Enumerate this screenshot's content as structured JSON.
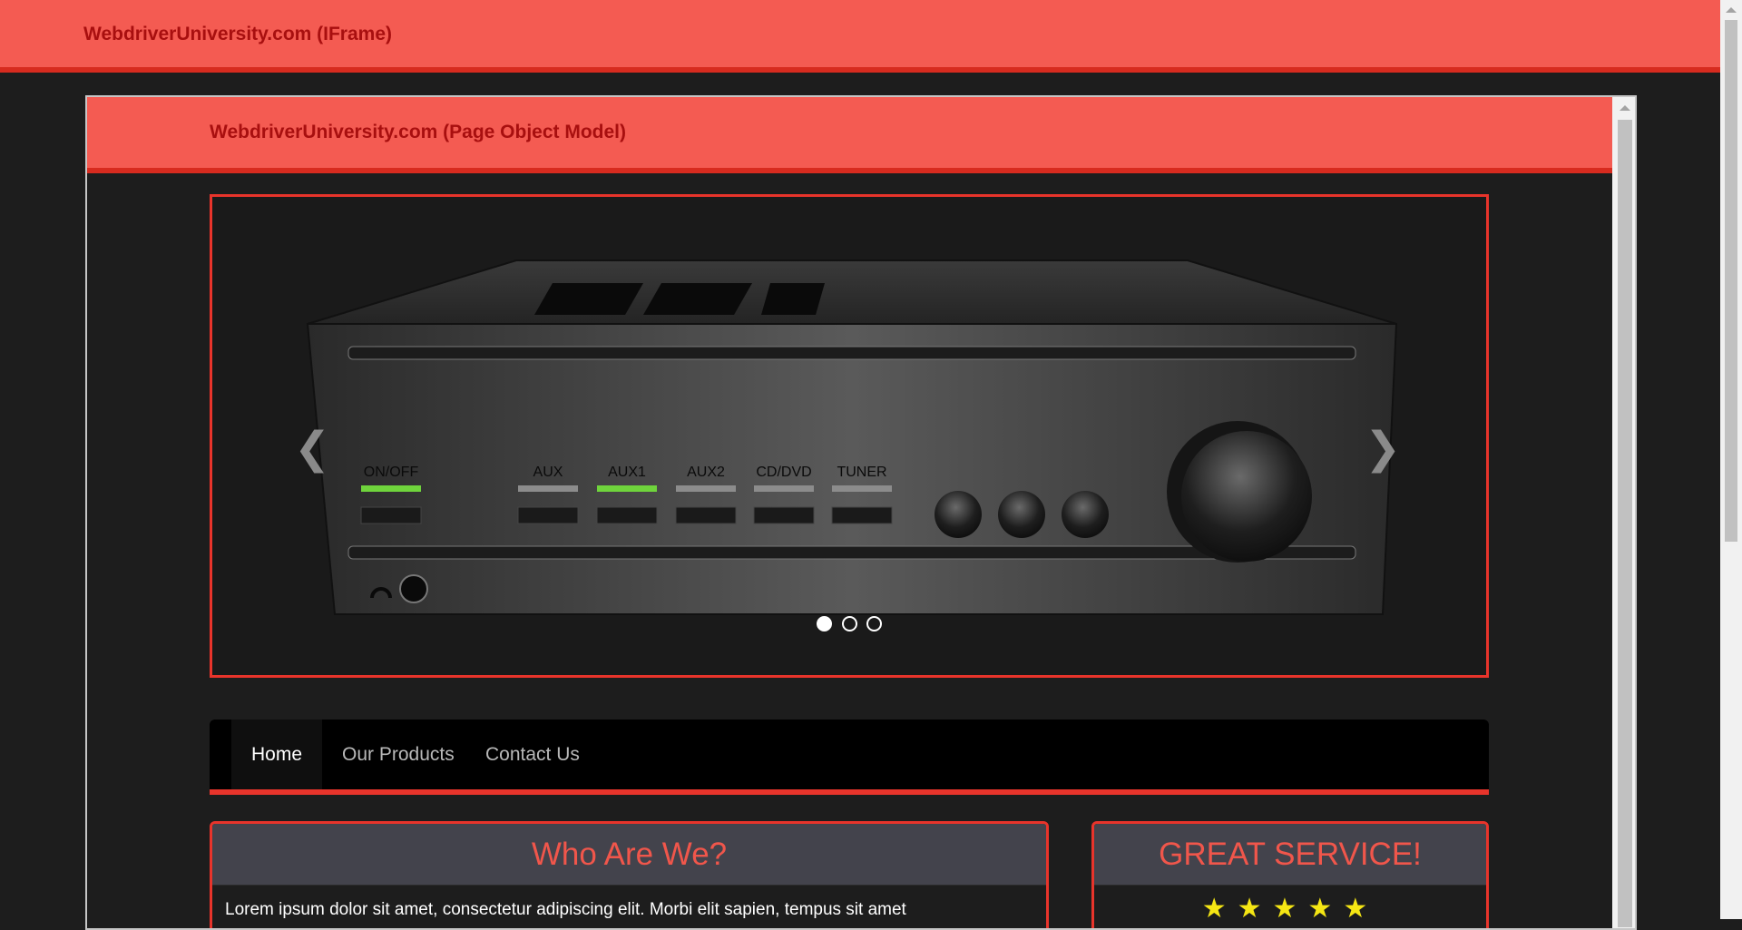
{
  "outer": {
    "brand": "WebdriverUniversity.com (IFrame)"
  },
  "iframe": {
    "brand": "WebdriverUniversity.com (Page Object Model)",
    "carousel": {
      "prev_icon": "chevron-left-icon",
      "next_icon": "chevron-right-icon",
      "indicators": [
        true,
        false,
        false
      ],
      "amp_labels": {
        "power": "ON/OFF",
        "aux": "AUX",
        "aux1": "AUX1",
        "aux2": "AUX2",
        "cd": "CD/DVD",
        "tuner": "TUNER"
      }
    },
    "nav": {
      "items": [
        "Home",
        "Our Products",
        "Contact Us"
      ],
      "active": "Home"
    },
    "panels": {
      "who": {
        "title": "Who Are We?",
        "body": "Lorem ipsum dolor sit amet, consectetur adipiscing elit. Morbi elit sapien, tempus sit amet"
      },
      "service": {
        "title": "GREAT SERVICE!",
        "stars": "★★★★★"
      }
    }
  },
  "colors": {
    "brand_red": "#f45b52",
    "accent_red": "#e8342b",
    "dark_bg": "#1d1d1d",
    "star_yellow": "#f5e614"
  }
}
